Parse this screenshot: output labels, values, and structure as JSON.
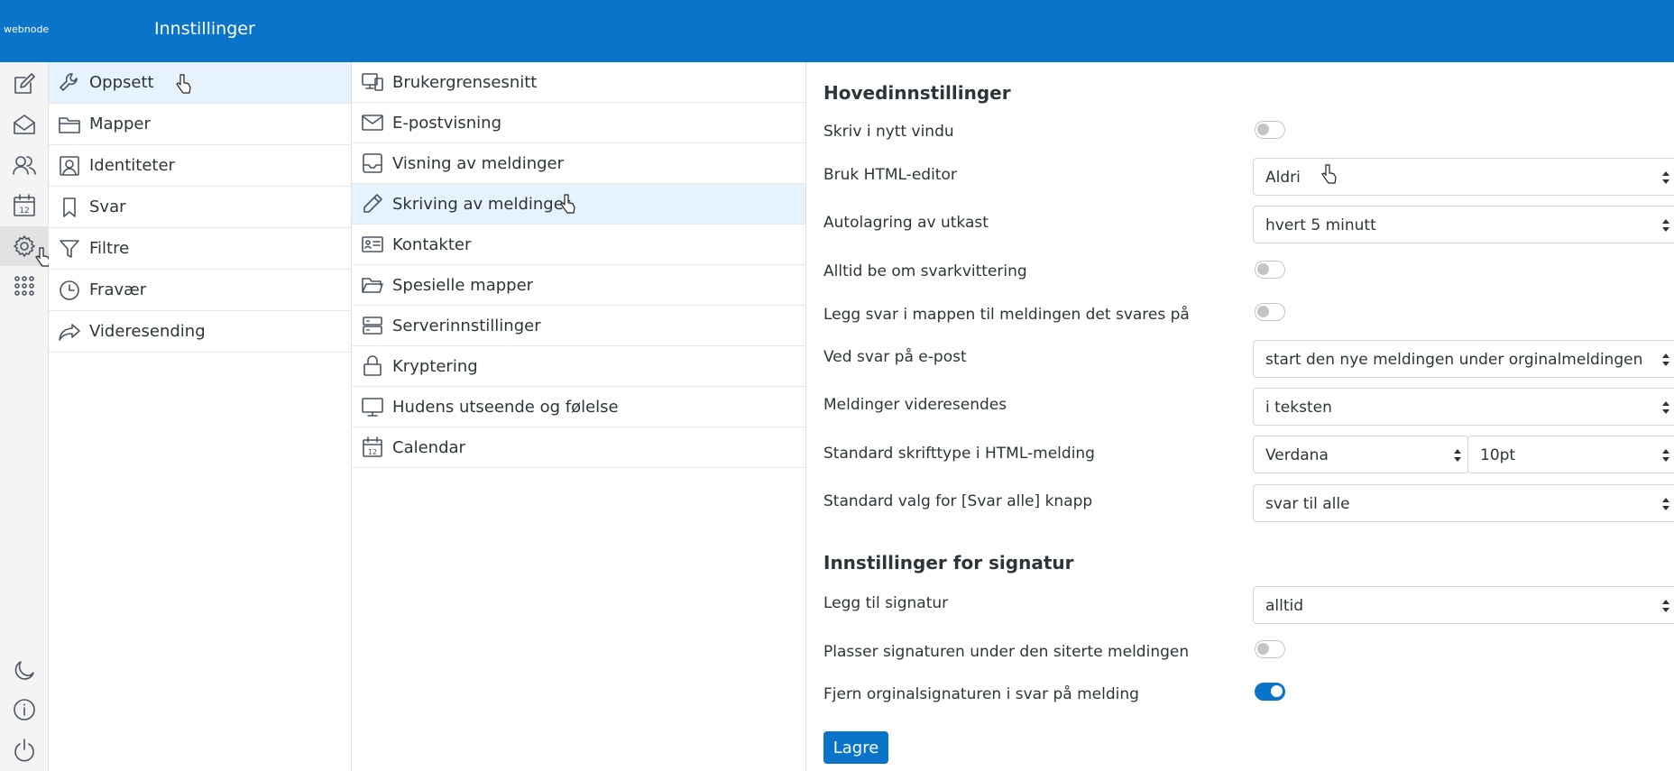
{
  "header": {
    "logo": "webnode",
    "title": "Innstillinger"
  },
  "iconbar": {
    "icons": [
      "compose-icon",
      "mail-icon",
      "contacts-icon",
      "calendar-icon",
      "settings-icon",
      "apps-icon",
      "dark-mode-icon",
      "info-icon",
      "logout-icon"
    ],
    "calendar_day": "12"
  },
  "settings_nav": {
    "items": [
      {
        "label": "Oppsett",
        "icon": "wrench-icon"
      },
      {
        "label": "Mapper",
        "icon": "folder-icon"
      },
      {
        "label": "Identiteter",
        "icon": "identity-icon"
      },
      {
        "label": "Svar",
        "icon": "bookmark-icon"
      },
      {
        "label": "Filtre",
        "icon": "filter-icon"
      },
      {
        "label": "Fravær",
        "icon": "clock-icon"
      },
      {
        "label": "Videresending",
        "icon": "forward-icon"
      }
    ]
  },
  "sections": {
    "items": [
      {
        "label": "Brukergrensesnitt",
        "icon": "devices-icon"
      },
      {
        "label": "E-postvisning",
        "icon": "envelope-icon"
      },
      {
        "label": "Visning av meldinger",
        "icon": "inbox-icon"
      },
      {
        "label": "Skriving av meldinger",
        "icon": "pencil-icon"
      },
      {
        "label": "Kontakter",
        "icon": "contact-card-icon"
      },
      {
        "label": "Spesielle mapper",
        "icon": "folder-open-icon"
      },
      {
        "label": "Serverinnstillinger",
        "icon": "server-icon"
      },
      {
        "label": "Kryptering",
        "icon": "lock-icon"
      },
      {
        "label": "Hudens utseende og følelse",
        "icon": "monitor-icon"
      },
      {
        "label": "Calendar",
        "icon": "calendar-icon"
      }
    ]
  },
  "main": {
    "section1_title": "Hovedinnstillinger",
    "rows": [
      {
        "label": "Skriv i nytt vindu",
        "toggle": false
      },
      {
        "label": "Bruk HTML-editor",
        "value": "Aldri"
      },
      {
        "label": "Autolagring av utkast",
        "value": "hvert 5 minutt"
      },
      {
        "label": "Alltid be om svarkvittering",
        "toggle": false
      },
      {
        "label": "Legg svar i mappen til meldingen det svares på",
        "toggle": false
      },
      {
        "label": "Ved svar på e-post",
        "value": "start den nye meldingen under orginalmeldingen"
      },
      {
        "label": "Meldinger videresendes",
        "value": "i teksten"
      },
      {
        "label": "Standard skrifttype i HTML-melding",
        "value": "Verdana",
        "value2": "10pt"
      },
      {
        "label": "Standard valg for [Svar alle] knapp",
        "value": "svar til alle"
      }
    ],
    "section2_title": "Innstillinger for signatur",
    "sig_rows": [
      {
        "label": "Legg til signatur",
        "value": "alltid"
      },
      {
        "label": "Plasser signaturen under den siterte meldingen",
        "toggle": false
      },
      {
        "label": "Fjern orginalsignaturen i svar på melding",
        "toggle": true
      }
    ],
    "save_label": "Lagre"
  },
  "colors": {
    "brand": "#0a74c9",
    "active_row": "#e6f3fc"
  }
}
